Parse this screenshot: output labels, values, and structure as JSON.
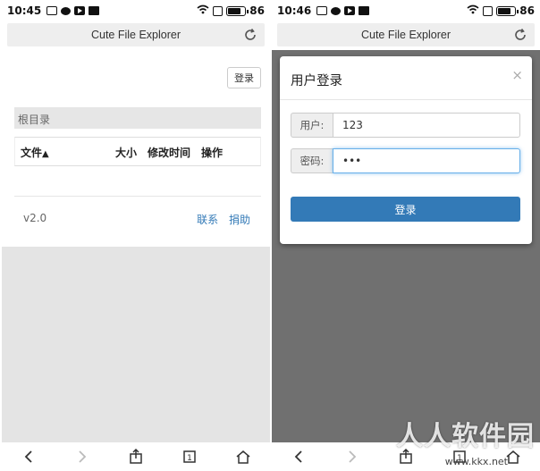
{
  "left_screen": {
    "status": {
      "time": "10:45",
      "battery": "86"
    },
    "app_title": "Cute File Explorer",
    "login_button": "登录",
    "breadcrumb": "根目录",
    "table_headers": {
      "name": "文件",
      "size": "大小",
      "mtime": "修改时间",
      "ops": "操作"
    },
    "version": "v2.0",
    "links": {
      "contact": "联系",
      "donate": "捐助"
    }
  },
  "right_screen": {
    "status": {
      "time": "10:46",
      "battery": "86"
    },
    "app_title": "Cute File Explorer",
    "modal": {
      "title": "用户登录",
      "close": "×",
      "username_label": "用户:",
      "username_value": "123",
      "password_label": "密码:",
      "password_value": "•••",
      "submit": "登录"
    }
  },
  "watermark": {
    "text": "人人软件园",
    "url": "www.kkx.net"
  },
  "colors": {
    "primary": "#337ab7",
    "overlay": "#707070",
    "page_grey": "#e4e4e4"
  },
  "icons": [
    "refresh-icon",
    "sort-up-icon",
    "back-icon",
    "forward-icon",
    "share-icon",
    "tabs-icon",
    "home-icon"
  ]
}
